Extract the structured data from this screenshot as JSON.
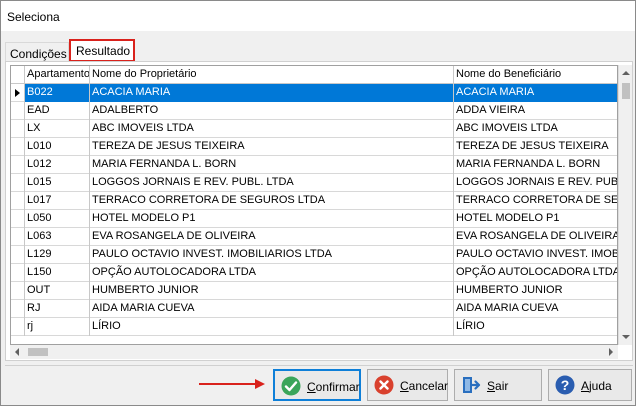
{
  "window": {
    "title": "Seleciona"
  },
  "tabs": [
    {
      "label": "Condições"
    },
    {
      "label": "Resultado"
    }
  ],
  "grid": {
    "columns": [
      "Apartamento",
      "Nome do Proprietário",
      "Nome do Beneficiário"
    ],
    "rows": [
      {
        "apto": "B022",
        "prop": "ACACIA MARIA",
        "benef": "ACACIA MARIA"
      },
      {
        "apto": "EAD",
        "prop": "ADALBERTO",
        "benef": "ADDA VIEIRA"
      },
      {
        "apto": "LX",
        "prop": "ABC IMOVEIS LTDA",
        "benef": "ABC IMOVEIS LTDA"
      },
      {
        "apto": "L010",
        "prop": "TEREZA DE JESUS TEIXEIRA",
        "benef": "TEREZA DE JESUS TEIXEIRA"
      },
      {
        "apto": "L012",
        "prop": "MARIA FERNANDA L. BORN",
        "benef": "MARIA FERNANDA L. BORN"
      },
      {
        "apto": "L015",
        "prop": "LOGGOS JORNAIS E REV. PUBL. LTDA",
        "benef": "LOGGOS JORNAIS E REV. PUBL"
      },
      {
        "apto": "L017",
        "prop": "TERRACO CORRETORA DE SEGUROS LTDA",
        "benef": "TERRACO CORRETORA DE SEGU"
      },
      {
        "apto": "L050",
        "prop": "HOTEL MODELO P1",
        "benef": "HOTEL MODELO P1"
      },
      {
        "apto": "L063",
        "prop": "EVA ROSANGELA DE OLIVEIRA",
        "benef": "EVA ROSANGELA DE OLIVEIRA"
      },
      {
        "apto": "L129",
        "prop": "PAULO OCTAVIO INVEST. IMOBILIARIOS LTDA",
        "benef": "PAULO OCTAVIO INVEST. IMOBIL"
      },
      {
        "apto": "L150",
        "prop": "OPÇÃO AUTOLOCADORA LTDA",
        "benef": "OPÇÃO AUTOLOCADORA LTDA"
      },
      {
        "apto": "OUT",
        "prop": "HUMBERTO JUNIOR",
        "benef": "HUMBERTO JUNIOR"
      },
      {
        "apto": "RJ",
        "prop": "AIDA MARIA CUEVA",
        "benef": "AIDA MARIA CUEVA"
      },
      {
        "apto": "rj",
        "prop": "LÍRIO",
        "benef": "LÍRIO"
      }
    ]
  },
  "buttons": {
    "confirm": {
      "pre": "",
      "key": "C",
      "post": "onfirmar",
      "icon": "check-icon",
      "color": "#3aa55a"
    },
    "cancel": {
      "pre": "",
      "key": "C",
      "post": "ancelar",
      "icon": "x-icon",
      "color": "#d9412e"
    },
    "exit": {
      "pre": "",
      "key": "S",
      "post": "air",
      "icon": "exit-door-icon",
      "color": "#2a6fbf"
    },
    "help": {
      "pre": "",
      "key": "A",
      "post": "juda",
      "icon": "question-icon",
      "color": "#2a5db0"
    }
  },
  "colors": {
    "selection": "#0078d7",
    "highlight": "#d9221c",
    "focus": "#0e7fd8"
  }
}
